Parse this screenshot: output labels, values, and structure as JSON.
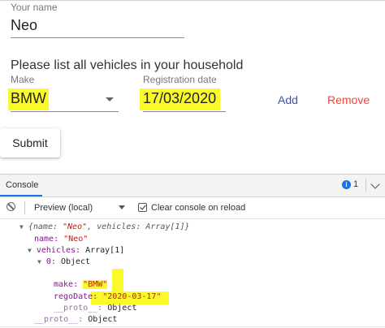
{
  "form": {
    "name_label": "Your name",
    "name_value": "Neo",
    "instruction": "Please list all vehicles in your household",
    "make_label": "Make",
    "make_value": "BMW",
    "rego_label": "Registration date",
    "rego_value": "17/03/2020",
    "add_label": "Add",
    "remove_label": "Remove",
    "submit_label": "Submit"
  },
  "devtools": {
    "tab_label": "Console",
    "issue_count": "1",
    "context_select": "Preview (local)",
    "clear_on_reload_label": "Clear console on reload",
    "clear_on_reload_checked": true,
    "log": {
      "summary_open": "{name: ",
      "summary_name": "\"Neo\"",
      "summary_mid": ", vehicles: ",
      "summary_vehicles": "Array[1]",
      "summary_close": "}",
      "name_key": "name:",
      "name_val": "\"Neo\"",
      "vehicles_key": "vehicles:",
      "vehicles_val": "Array[1]",
      "item0_key": "0:",
      "item0_val": "Object",
      "make_key": "make:",
      "make_val": "\"BMW\"",
      "rego_key": "regoDate:",
      "rego_val": "\"2020-03-17\"",
      "proto_inner_key": "__proto__:",
      "proto_inner_val": "Object",
      "proto_outer_key": "__proto__:",
      "proto_outer_val": "Object"
    }
  },
  "colors": {
    "highlight": "#fafa2a",
    "add": "#3f51b5",
    "remove": "#f44336",
    "key": "#881391",
    "string": "#c41a16",
    "info": "#1a73e8"
  }
}
